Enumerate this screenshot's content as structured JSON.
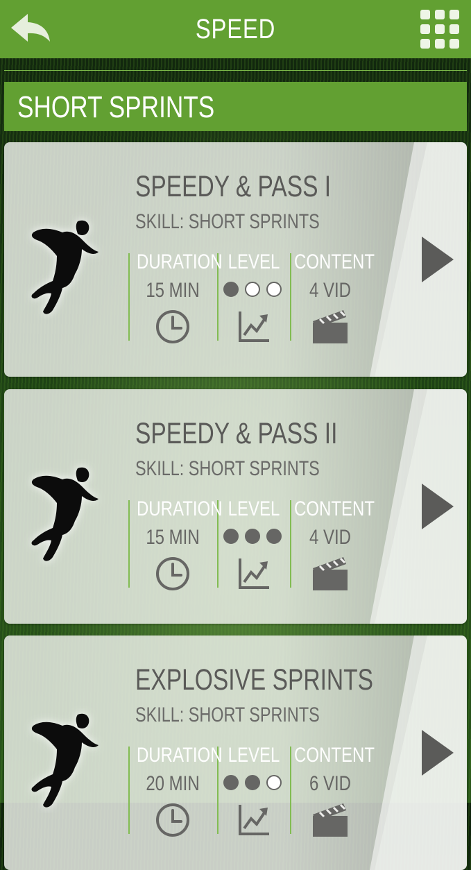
{
  "header": {
    "title": "SPEED"
  },
  "section": {
    "title": "SHORT SPRINTS"
  },
  "stat_labels": {
    "duration": "DURATION",
    "level": "LEVEL",
    "content": "CONTENT"
  },
  "cards": [
    {
      "title": "SPEEDY & PASS I",
      "skill": "SKILL: SHORT SPRINTS",
      "duration": "15 MIN",
      "level_filled": 1,
      "level_total": 3,
      "content": "4 VID"
    },
    {
      "title": "SPEEDY & PASS II",
      "skill": "SKILL: SHORT SPRINTS",
      "duration": "15 MIN",
      "level_filled": 3,
      "level_total": 3,
      "content": "4 VID"
    },
    {
      "title": "EXPLOSIVE SPRINTS",
      "skill": "SKILL: SHORT SPRINTS",
      "duration": "20 MIN",
      "level_filled": 2,
      "level_total": 3,
      "content": "6 VID"
    }
  ],
  "colors": {
    "brand_green": "#62a032",
    "text_gray": "#666664"
  }
}
